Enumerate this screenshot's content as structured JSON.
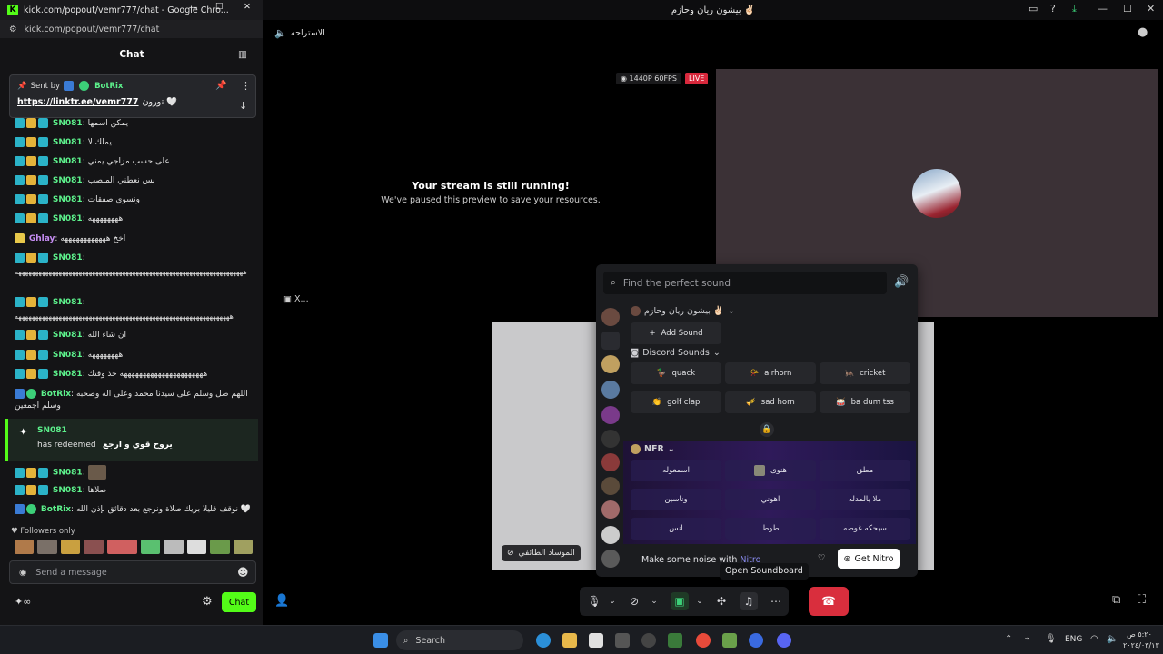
{
  "chrome": {
    "window_title": "kick.com/popout/vemr777/chat - Google Chro...",
    "url": "kick.com/popout/vemr777/chat",
    "chat_header": "Chat",
    "pinned": {
      "sent_by_label": "Sent by",
      "sender": "BotRix",
      "link": "https://linktr.ee/vemr777",
      "link_suffix": "تورون 🤍"
    },
    "messages": [
      {
        "user": "SN081",
        "text": "يمكن اسمها"
      },
      {
        "user": "SN081",
        "text": "يملك لا"
      },
      {
        "user": "SN081",
        "text": "على حسب مزاجي يمني"
      },
      {
        "user": "SN081",
        "text": "بس نعطني المنصب"
      },
      {
        "user": "SN081",
        "text": "ونسوي صفقات"
      },
      {
        "user": "SN081",
        "text": "ههههههههه"
      },
      {
        "user": "Ghlay",
        "text": "اخخ ههههههههههههه"
      },
      {
        "user": "SN081",
        "text": ""
      },
      {
        "user": "SN081",
        "text": ""
      },
      {
        "user": "SN081",
        "text": "ان شاء الله"
      },
      {
        "user": "SN081",
        "text": "ههههههههه"
      },
      {
        "user": "SN081",
        "text": "ههههههههههههههههههههههه خذ وقتك"
      },
      {
        "user": "BotRix",
        "text": "اللهم صل وسلم على سيدنا محمد وعلى اله وصحبه وسلم اجمعين"
      },
      {
        "user": "SN081",
        "text": ""
      },
      {
        "user": "SN081",
        "text": "صلاها"
      },
      {
        "user": "BotRix",
        "text": "نوقف قليلا بريك صلاة ونرجع بعد دقائق بإذن الله 🤍"
      }
    ],
    "long_laugh_1": "ههههههههههههههههههههههههههههههههههههههههههههههههههههههههههههههههههههه",
    "long_laugh_2": "ههههههههههههههههههههههههههههههههههههههههههههههههههههههههههههههههه",
    "redeem": {
      "user": "SN081",
      "action": "has redeemed",
      "reward": "يروح قوي و ارجع"
    },
    "followers_only": "Followers only",
    "input_placeholder": "Send a message",
    "chat_button": "Chat"
  },
  "discord": {
    "window_title": "بيشون ريان وحازم ✌🏻",
    "channel_name": "الاستراحه",
    "quality_badge": "1440P 60FPS",
    "live_badge": "LIVE",
    "paused_title": "Your stream is still running!",
    "paused_subtitle": "We've paused this preview to save your resources.",
    "side_label": "X...",
    "tile_label": "الموساد الطائفي",
    "soundboard": {
      "search_placeholder": "Find the perfect sound",
      "server_name": "بيشون ريان وحازم ✌🏻",
      "add_sound": "Add Sound",
      "discord_category": "Discord Sounds",
      "discord_sounds": [
        "quack",
        "airhorn",
        "cricket",
        "golf clap",
        "sad horn",
        "ba dum tss"
      ],
      "nfr_category": "NFR",
      "nfr_sounds": [
        "اسمعوله",
        "هنوى",
        "مطق",
        "وناسين",
        "اهوني",
        "ملا بالمدله",
        "انس",
        "طوط",
        "سبحكه غوصه"
      ],
      "nitro_text": "Make some noise with",
      "nitro_word": "Nitro",
      "get_nitro": "Get Nitro"
    },
    "tooltip": "Open Soundboard"
  },
  "taskbar": {
    "search": "Search",
    "lang": "ENG",
    "time": "٥:٢٠ ص",
    "date": "٢٠٢٤/٠٣/١٣"
  },
  "colors": {
    "kick_green": "#53fc18",
    "live_red": "#d8283c",
    "hangup_red": "#d92e3d",
    "nitro_link": "#8a8cf0"
  }
}
